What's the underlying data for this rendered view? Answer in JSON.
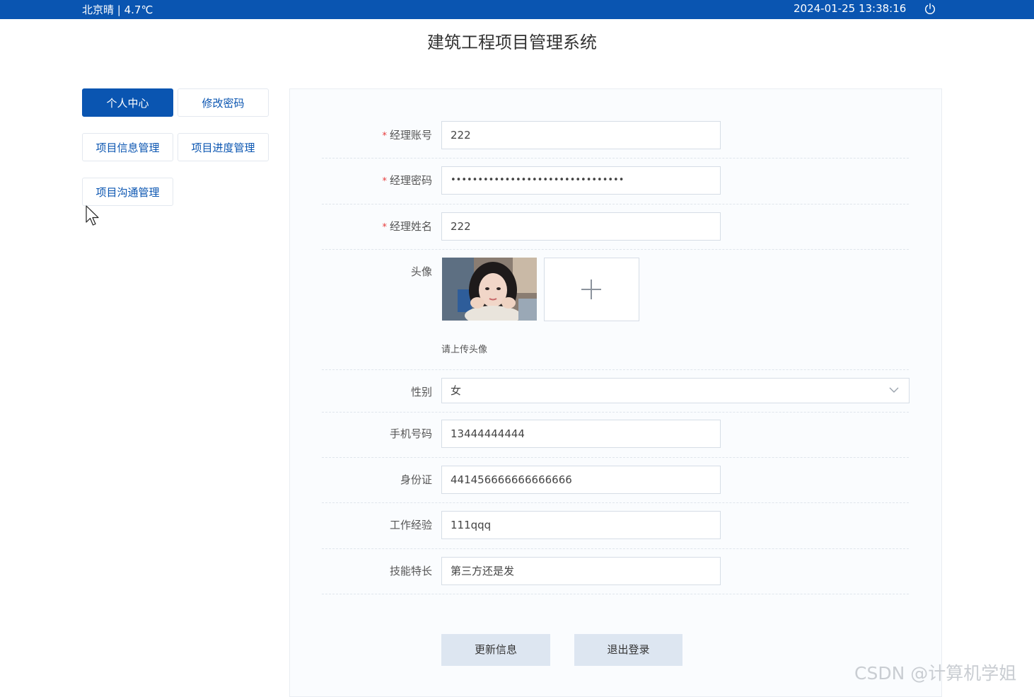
{
  "topbar": {
    "weather": "北京晴 | 4.7℃",
    "datetime": "2024-01-25  13:38:16",
    "power_icon": "power-icon"
  },
  "title": "建筑工程项目管理系统",
  "sidebar": {
    "items": [
      {
        "label": "个人中心",
        "active": true
      },
      {
        "label": "修改密码",
        "active": false
      },
      {
        "label": "项目信息管理",
        "active": false
      },
      {
        "label": "项目进度管理",
        "active": false
      },
      {
        "label": "项目沟通管理",
        "active": false
      }
    ]
  },
  "form": {
    "account": {
      "label": "经理账号",
      "value": "222",
      "required": true
    },
    "password": {
      "label": "经理密码",
      "value": "••••••••••••••••••••••••••••••••",
      "required": true
    },
    "name": {
      "label": "经理姓名",
      "value": "222",
      "required": true
    },
    "avatar": {
      "label": "头像",
      "hint": "请上传头像"
    },
    "gender": {
      "label": "性别",
      "value": "女"
    },
    "phone": {
      "label": "手机号码",
      "value": "13444444444"
    },
    "id_card": {
      "label": "身份证",
      "value": "441456666666666666"
    },
    "experience": {
      "label": "工作经验",
      "value": "111qqq"
    },
    "skills": {
      "label": "技能特长",
      "value": "第三方还是发"
    }
  },
  "buttons": {
    "update": "更新信息",
    "logout": "退出登录"
  },
  "watermark": "CSDN @计算机学姐",
  "colors": {
    "primary": "#0a55b1",
    "required": "#e63a3a",
    "button_bg": "#dde6f1"
  }
}
